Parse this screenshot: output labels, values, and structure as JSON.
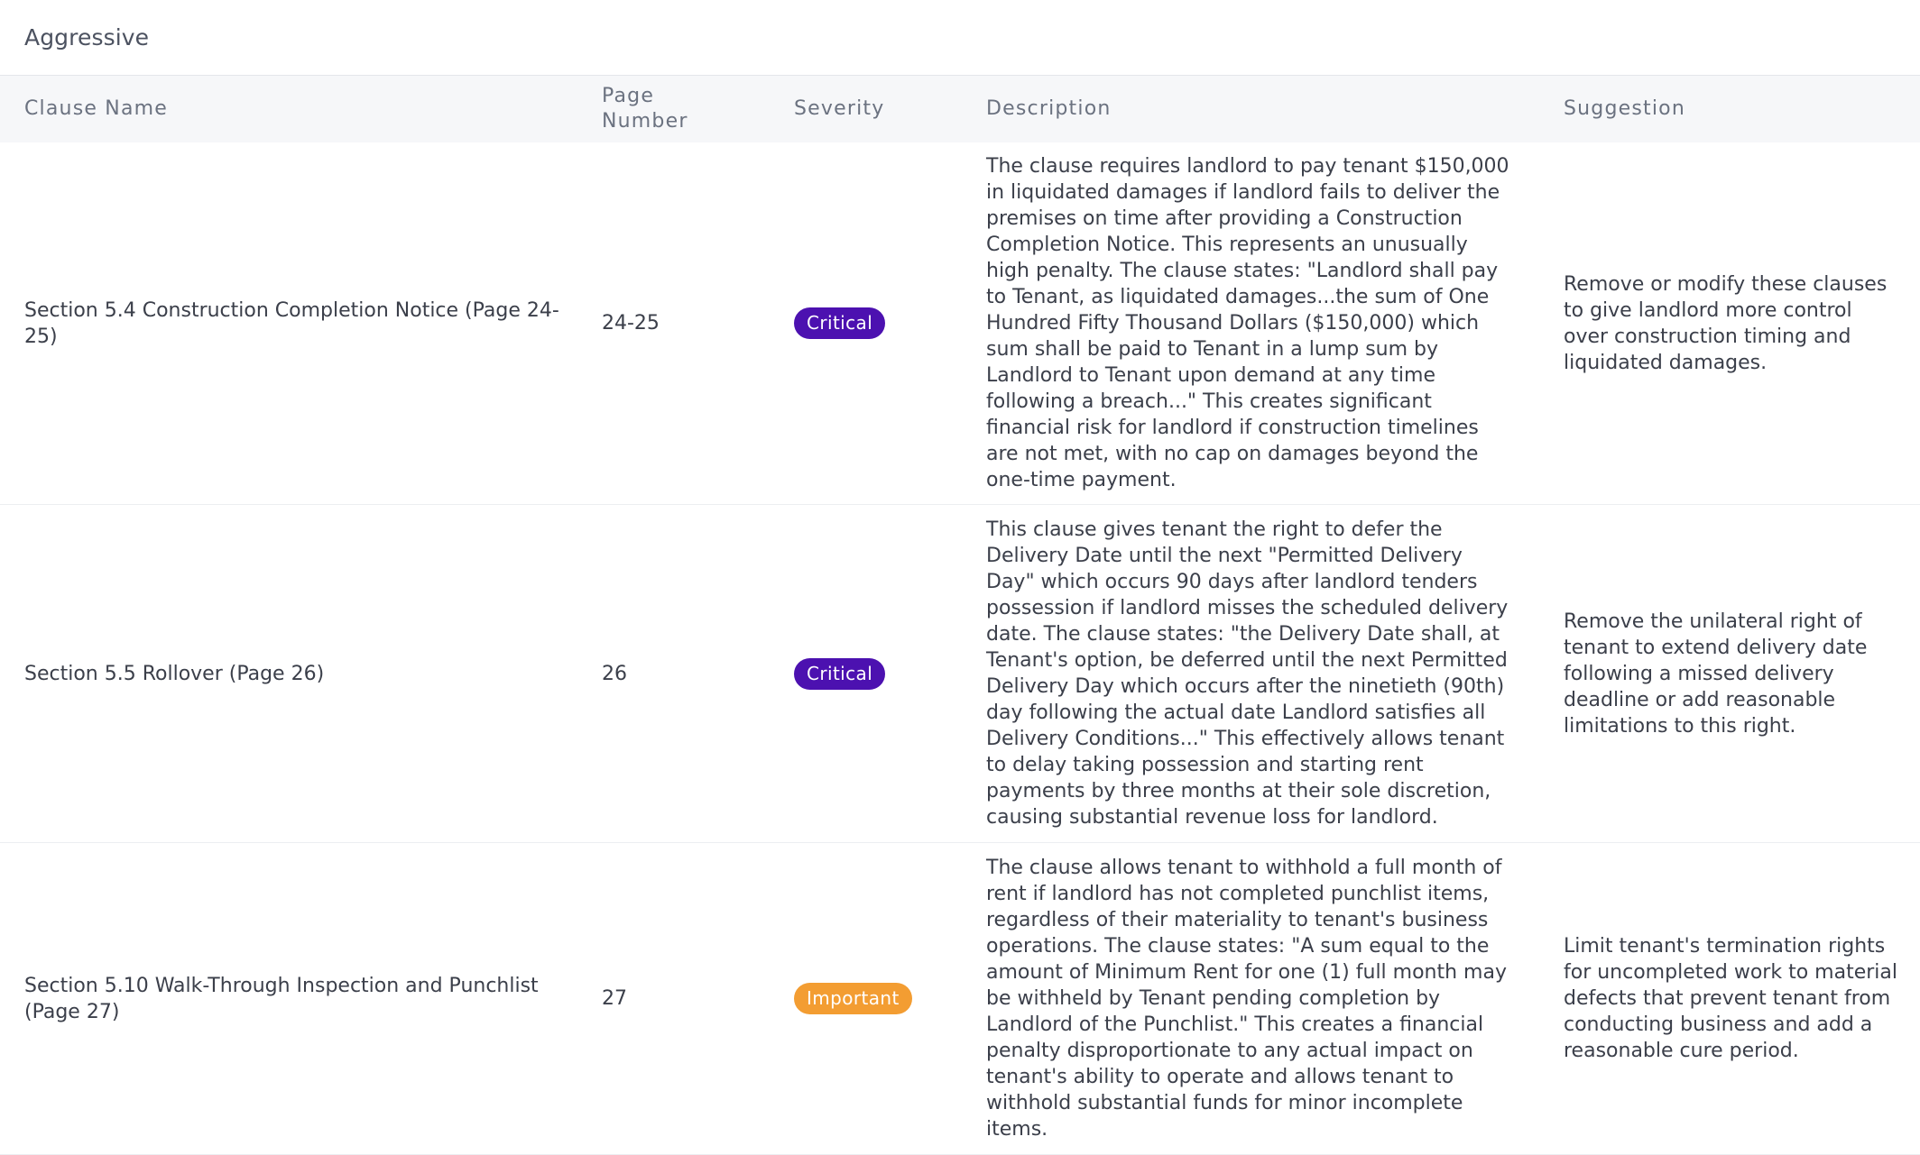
{
  "panel": {
    "title": "Aggressive"
  },
  "table": {
    "headers": {
      "clause_name": "Clause Name",
      "page_number": "Page Number",
      "severity": "Severity",
      "description": "Description",
      "suggestion": "Suggestion"
    },
    "rows": [
      {
        "clause_name": "Section 5.4 Construction Completion Notice (Page 24-25)",
        "page_number": "24-25",
        "severity": "Critical",
        "description": "The clause requires landlord to pay tenant $150,000 in liquidated damages if landlord fails to deliver the premises on time after providing a Construction Completion Notice. This represents an unusually high penalty. The clause states: \"Landlord shall pay to Tenant, as liquidated damages...the sum of One Hundred Fifty Thousand Dollars ($150,000) which sum shall be paid to Tenant in a lump sum by Landlord to Tenant upon demand at any time following a breach...\" This creates significant financial risk for landlord if construction timelines are not met, with no cap on damages beyond the one-time payment.",
        "suggestion": "Remove or modify these clauses to give landlord more control over construction timing and liquidated damages."
      },
      {
        "clause_name": "Section 5.5 Rollover (Page 26)",
        "page_number": "26",
        "severity": "Critical",
        "description": "This clause gives tenant the right to defer the Delivery Date until the next \"Permitted Delivery Day\" which occurs 90 days after landlord tenders possession if landlord misses the scheduled delivery date. The clause states: \"the Delivery Date shall, at Tenant's option, be deferred until the next Permitted Delivery Day which occurs after the ninetieth (90th) day following the actual date Landlord satisfies all Delivery Conditions...\" This effectively allows tenant to delay taking possession and starting rent payments by three months at their sole discretion, causing substantial revenue loss for landlord.",
        "suggestion": "Remove the unilateral right of tenant to extend delivery date following a missed delivery deadline or add reasonable limitations to this right."
      },
      {
        "clause_name": "Section 5.10 Walk-Through Inspection and Punchlist (Page 27)",
        "page_number": "27",
        "severity": "Important",
        "description": "The clause allows tenant to withhold a full month of rent if landlord has not completed punchlist items, regardless of their materiality to tenant's business operations. The clause states: \"A sum equal to the amount of Minimum Rent for one (1) full month may be withheld by Tenant pending completion by Landlord of the Punchlist.\" This creates a financial penalty disproportionate to any actual impact on tenant's ability to operate and allows tenant to withhold substantial funds for minor incomplete items.",
        "suggestion": "Limit tenant's termination rights for uncompleted work to material defects that prevent tenant from conducting business and add a reasonable cure period."
      }
    ]
  },
  "colors": {
    "critical_badge": "#4c11b0",
    "important_badge": "#f39d32",
    "header_background": "#f6f7f9"
  }
}
